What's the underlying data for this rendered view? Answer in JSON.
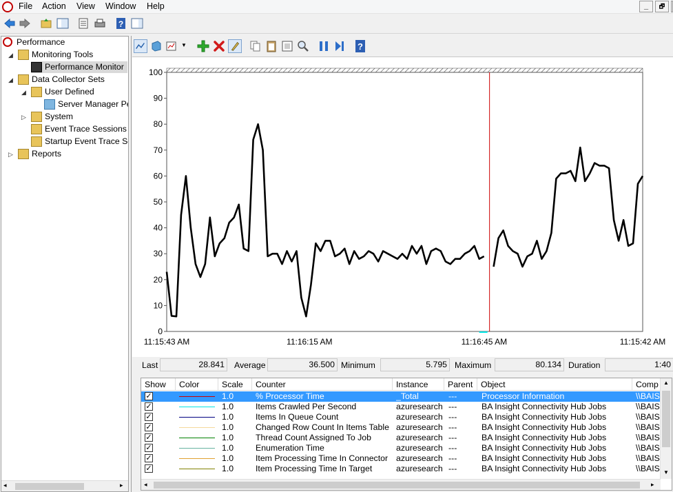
{
  "menubar": {
    "items": [
      "File",
      "Action",
      "View",
      "Window",
      "Help"
    ],
    "window_buttons": [
      "_",
      "🗗",
      "✕"
    ]
  },
  "tree": {
    "root": "Performance",
    "monitoring_tools": "Monitoring Tools",
    "performance_monitor": "Performance Monitor",
    "data_collector_sets": "Data Collector Sets",
    "user_defined": "User Defined",
    "server_manager": "Server Manager Per",
    "system": "System",
    "event_trace": "Event Trace Sessions",
    "startup_trace": "Startup Event Trace Ses",
    "reports": "Reports"
  },
  "stats": {
    "last_label": "Last",
    "last_value": "28.841",
    "average_label": "Average",
    "average_value": "36.500",
    "minimum_label": "Minimum",
    "minimum_value": "5.795",
    "maximum_label": "Maximum",
    "maximum_value": "80.134",
    "duration_label": "Duration",
    "duration_value": "1:40"
  },
  "table": {
    "headers": [
      "Show",
      "Color",
      "Scale",
      "Counter",
      "Instance",
      "Parent",
      "Object",
      "Comp"
    ],
    "rows": [
      {
        "scale": "1.0",
        "counter": "% Processor Time",
        "instance": "_Total",
        "parent": "---",
        "object": "Processor Information",
        "comp": "\\\\BAIS",
        "color": "#cc0000"
      },
      {
        "scale": "1.0",
        "counter": "Items Crawled Per Second",
        "instance": "azuresearch",
        "parent": "---",
        "object": "BA Insight Connectivity Hub Jobs",
        "comp": "\\\\BAIS",
        "color": "#00e5e5"
      },
      {
        "scale": "1.0",
        "counter": "Items In Queue Count",
        "instance": "azuresearch",
        "parent": "---",
        "object": "BA Insight Connectivity Hub Jobs",
        "comp": "\\\\BAIS",
        "color": "#000080"
      },
      {
        "scale": "1.0",
        "counter": "Changed Row Count In Items Table",
        "instance": "azuresearch",
        "parent": "---",
        "object": "BA Insight Connectivity Hub Jobs",
        "comp": "\\\\BAIS",
        "color": "#f5d89a"
      },
      {
        "scale": "1.0",
        "counter": "Thread Count Assigned To Job",
        "instance": "azuresearch",
        "parent": "---",
        "object": "BA Insight Connectivity Hub Jobs",
        "comp": "\\\\BAIS",
        "color": "#008000"
      },
      {
        "scale": "1.0",
        "counter": "Enumeration Time",
        "instance": "azuresearch",
        "parent": "---",
        "object": "BA Insight Connectivity Hub Jobs",
        "comp": "\\\\BAIS",
        "color": "#66b2a0"
      },
      {
        "scale": "1.0",
        "counter": "Item Processing Time In Connector",
        "instance": "azuresearch",
        "parent": "---",
        "object": "BA Insight Connectivity Hub Jobs",
        "comp": "\\\\BAIS",
        "color": "#e0a030"
      },
      {
        "scale": "1.0",
        "counter": "Item Processing Time In Target",
        "instance": "azuresearch",
        "parent": "---",
        "object": "BA Insight Connectivity Hub Jobs",
        "comp": "\\\\BAIS",
        "color": "#808000"
      }
    ]
  },
  "chart_data": {
    "type": "line",
    "ylim": [
      0,
      100
    ],
    "yticks": [
      "100",
      "90",
      "80",
      "70",
      "60",
      "50",
      "40",
      "30",
      "20",
      "10",
      "0"
    ],
    "xticks": [
      "11:15:43 AM",
      "11:16:15 AM",
      "11:16:45 AM",
      "11:15:42 AM"
    ],
    "series": [
      {
        "values": [
          23,
          6,
          5.8,
          45,
          60,
          40,
          26,
          21,
          26,
          44,
          29,
          34,
          36,
          42,
          44,
          49,
          32,
          31,
          74,
          80,
          70,
          29,
          30,
          30,
          26,
          31,
          27,
          31,
          13,
          5.8,
          18,
          34,
          31,
          35,
          35,
          29,
          30,
          32,
          26,
          31,
          28,
          29,
          31,
          30,
          27,
          31,
          30,
          29,
          28,
          30,
          28,
          33,
          30,
          33,
          26,
          31,
          32,
          31,
          27,
          26,
          28,
          28,
          30,
          31,
          33,
          28,
          29,
          null,
          25,
          36,
          39,
          33,
          31,
          30,
          25,
          29,
          30,
          35,
          28,
          31,
          38,
          59,
          61,
          61,
          62,
          58,
          71,
          58,
          61,
          65,
          64,
          64,
          63,
          43,
          35,
          43,
          33,
          34,
          57,
          60
        ]
      }
    ],
    "current_index": 67
  },
  "colors": {
    "line": "#000000",
    "cursor": "#cc0000",
    "selection": "#3399ff"
  }
}
